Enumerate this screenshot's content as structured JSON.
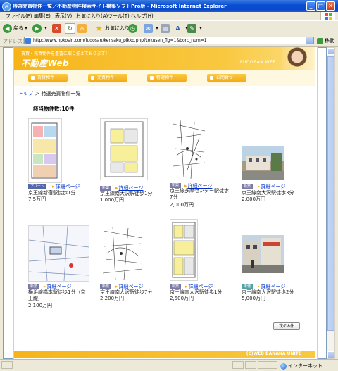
{
  "window": {
    "title": "特選売買物件一覧／不動産物件検索サイト構築ソフトPro版 - Microsoft Internet Explorer",
    "controls": {
      "minimize": "_",
      "maximize": "□",
      "close": "✕"
    }
  },
  "menu": [
    "ファイル(F)",
    "編集(E)",
    "表示(V)",
    "お気に入り(A)",
    "ツール(T)",
    "ヘルプ(H)"
  ],
  "toolbar": {
    "back": "戻る",
    "favorites": "お気に入り"
  },
  "address": {
    "label": "アドレス(D)",
    "url": "http://www.hpkosin.com/fudosan/kensaku_pikko.php?tokusen_flg=1&borc_num=1",
    "go": "移動"
  },
  "site": {
    "catch": "賃貸・売買物件を豊富に取り揃えております！",
    "logo": "不動産Web",
    "brand": "FUDOSAN WEB"
  },
  "nav": [
    "賃貸物件",
    "売買物件",
    "特選物件",
    "お問合せ"
  ],
  "breadcrumb": {
    "home": "トップ",
    "sep": "＞",
    "current": "特選売買物件一覧"
  },
  "count": "該当物件数:10件",
  "listings": [
    {
      "tag": "アパート",
      "tag_style": "apt",
      "detail": "詳細ページ",
      "line1": "京王線新宿駅徒歩1分",
      "price": "7.5万円",
      "thumb": "floorplan-color"
    },
    {
      "tag": "新築",
      "tag_style": "new",
      "detail": "詳細ページ",
      "line1": "京王線南大沢駅徒歩1分",
      "price": "1,000万円",
      "thumb": "floorplan-yellow"
    },
    {
      "tag": "新築",
      "tag_style": "new",
      "detail": "詳細ページ",
      "line1": "京王線多摩センター駅徒歩7分",
      "price": "2,000万円",
      "thumb": "map"
    },
    {
      "tag": "新築",
      "tag_style": "new",
      "detail": "詳細ページ",
      "line1": "京王線南大沢駅徒歩3分",
      "price": "2,000万円",
      "thumb": "photo-building"
    },
    {
      "tag": "新築",
      "tag_style": "new",
      "detail": "詳細ページ",
      "line1": "横浜線橋本駅徒歩1分（京王線）",
      "price": "2,100万円",
      "thumb": "map-blue"
    },
    {
      "tag": "新築",
      "tag_style": "new",
      "detail": "詳細ページ",
      "line1": "京王線南大沢駅徒歩7分",
      "price": "2,200万円",
      "thumb": "map"
    },
    {
      "tag": "新築",
      "tag_style": "new",
      "detail": "詳細ページ",
      "line1": "京王線南大沢駅徒歩1分",
      "price": "2,500万円",
      "thumb": "floorplan-yellow"
    },
    {
      "tag": "未使",
      "tag_style": "newb",
      "detail": "詳細ページ",
      "line1": "京王線南大沢駅徒歩2分",
      "price": "5,000万円",
      "thumb": "photo-street"
    }
  ],
  "next": "次の8件",
  "footer": "(C)WEB BANANA UNITE",
  "status": {
    "zone": "インターネット"
  },
  "colors": {
    "accent": "#f6b41a",
    "link": "#0033cc",
    "titlebar": "#0a4fd6"
  }
}
